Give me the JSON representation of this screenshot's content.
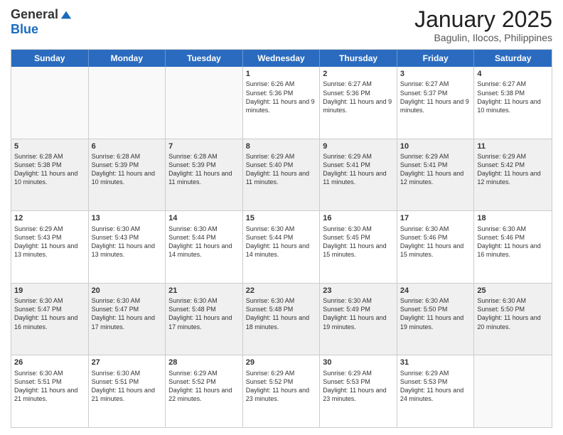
{
  "logo": {
    "general": "General",
    "blue": "Blue"
  },
  "header": {
    "month": "January 2025",
    "location": "Bagulin, Ilocos, Philippines"
  },
  "days": [
    "Sunday",
    "Monday",
    "Tuesday",
    "Wednesday",
    "Thursday",
    "Friday",
    "Saturday"
  ],
  "weeks": [
    [
      {
        "day": "",
        "text": ""
      },
      {
        "day": "",
        "text": ""
      },
      {
        "day": "",
        "text": ""
      },
      {
        "day": "1",
        "text": "Sunrise: 6:26 AM\nSunset: 5:36 PM\nDaylight: 11 hours and 9 minutes."
      },
      {
        "day": "2",
        "text": "Sunrise: 6:27 AM\nSunset: 5:36 PM\nDaylight: 11 hours and 9 minutes."
      },
      {
        "day": "3",
        "text": "Sunrise: 6:27 AM\nSunset: 5:37 PM\nDaylight: 11 hours and 9 minutes."
      },
      {
        "day": "4",
        "text": "Sunrise: 6:27 AM\nSunset: 5:38 PM\nDaylight: 11 hours and 10 minutes."
      }
    ],
    [
      {
        "day": "5",
        "text": "Sunrise: 6:28 AM\nSunset: 5:38 PM\nDaylight: 11 hours and 10 minutes."
      },
      {
        "day": "6",
        "text": "Sunrise: 6:28 AM\nSunset: 5:39 PM\nDaylight: 11 hours and 10 minutes."
      },
      {
        "day": "7",
        "text": "Sunrise: 6:28 AM\nSunset: 5:39 PM\nDaylight: 11 hours and 11 minutes."
      },
      {
        "day": "8",
        "text": "Sunrise: 6:29 AM\nSunset: 5:40 PM\nDaylight: 11 hours and 11 minutes."
      },
      {
        "day": "9",
        "text": "Sunrise: 6:29 AM\nSunset: 5:41 PM\nDaylight: 11 hours and 11 minutes."
      },
      {
        "day": "10",
        "text": "Sunrise: 6:29 AM\nSunset: 5:41 PM\nDaylight: 11 hours and 12 minutes."
      },
      {
        "day": "11",
        "text": "Sunrise: 6:29 AM\nSunset: 5:42 PM\nDaylight: 11 hours and 12 minutes."
      }
    ],
    [
      {
        "day": "12",
        "text": "Sunrise: 6:29 AM\nSunset: 5:43 PM\nDaylight: 11 hours and 13 minutes."
      },
      {
        "day": "13",
        "text": "Sunrise: 6:30 AM\nSunset: 5:43 PM\nDaylight: 11 hours and 13 minutes."
      },
      {
        "day": "14",
        "text": "Sunrise: 6:30 AM\nSunset: 5:44 PM\nDaylight: 11 hours and 14 minutes."
      },
      {
        "day": "15",
        "text": "Sunrise: 6:30 AM\nSunset: 5:44 PM\nDaylight: 11 hours and 14 minutes."
      },
      {
        "day": "16",
        "text": "Sunrise: 6:30 AM\nSunset: 5:45 PM\nDaylight: 11 hours and 15 minutes."
      },
      {
        "day": "17",
        "text": "Sunrise: 6:30 AM\nSunset: 5:46 PM\nDaylight: 11 hours and 15 minutes."
      },
      {
        "day": "18",
        "text": "Sunrise: 6:30 AM\nSunset: 5:46 PM\nDaylight: 11 hours and 16 minutes."
      }
    ],
    [
      {
        "day": "19",
        "text": "Sunrise: 6:30 AM\nSunset: 5:47 PM\nDaylight: 11 hours and 16 minutes."
      },
      {
        "day": "20",
        "text": "Sunrise: 6:30 AM\nSunset: 5:47 PM\nDaylight: 11 hours and 17 minutes."
      },
      {
        "day": "21",
        "text": "Sunrise: 6:30 AM\nSunset: 5:48 PM\nDaylight: 11 hours and 17 minutes."
      },
      {
        "day": "22",
        "text": "Sunrise: 6:30 AM\nSunset: 5:48 PM\nDaylight: 11 hours and 18 minutes."
      },
      {
        "day": "23",
        "text": "Sunrise: 6:30 AM\nSunset: 5:49 PM\nDaylight: 11 hours and 19 minutes."
      },
      {
        "day": "24",
        "text": "Sunrise: 6:30 AM\nSunset: 5:50 PM\nDaylight: 11 hours and 19 minutes."
      },
      {
        "day": "25",
        "text": "Sunrise: 6:30 AM\nSunset: 5:50 PM\nDaylight: 11 hours and 20 minutes."
      }
    ],
    [
      {
        "day": "26",
        "text": "Sunrise: 6:30 AM\nSunset: 5:51 PM\nDaylight: 11 hours and 21 minutes."
      },
      {
        "day": "27",
        "text": "Sunrise: 6:30 AM\nSunset: 5:51 PM\nDaylight: 11 hours and 21 minutes."
      },
      {
        "day": "28",
        "text": "Sunrise: 6:29 AM\nSunset: 5:52 PM\nDaylight: 11 hours and 22 minutes."
      },
      {
        "day": "29",
        "text": "Sunrise: 6:29 AM\nSunset: 5:52 PM\nDaylight: 11 hours and 23 minutes."
      },
      {
        "day": "30",
        "text": "Sunrise: 6:29 AM\nSunset: 5:53 PM\nDaylight: 11 hours and 23 minutes."
      },
      {
        "day": "31",
        "text": "Sunrise: 6:29 AM\nSunset: 5:53 PM\nDaylight: 11 hours and 24 minutes."
      },
      {
        "day": "",
        "text": ""
      }
    ]
  ]
}
